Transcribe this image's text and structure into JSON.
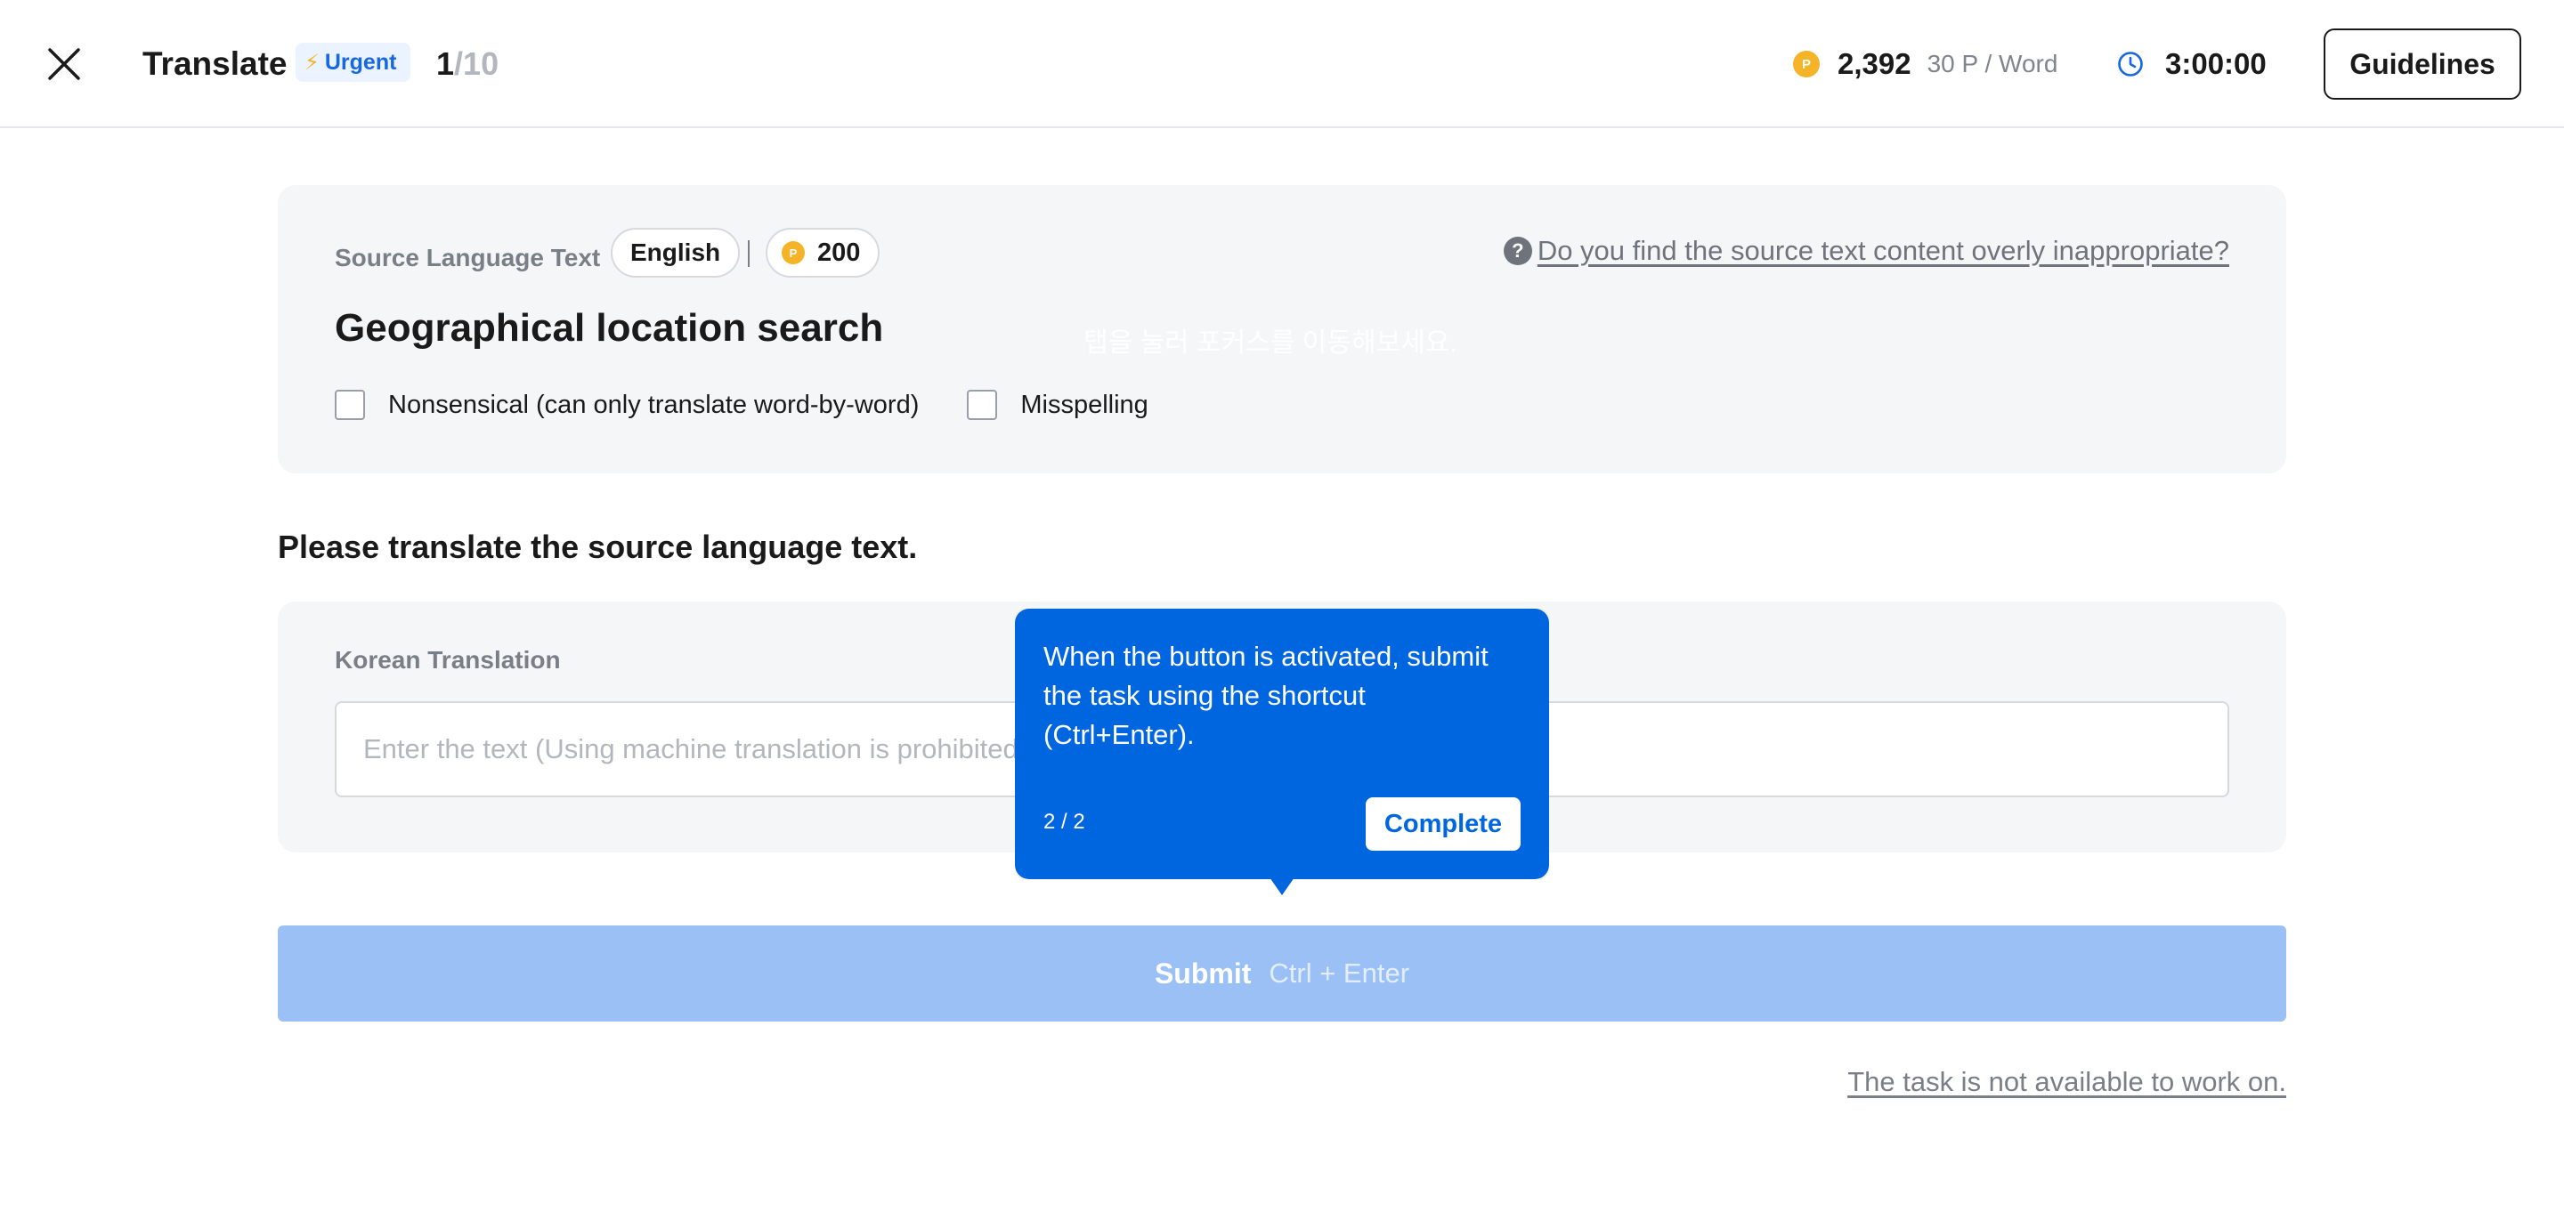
{
  "header": {
    "title": "Translate",
    "urgent_label": "Urgent",
    "progress_current": "1",
    "progress_separator": "/",
    "progress_total": "10",
    "points_coin": "P",
    "points_value": "2,392",
    "points_rate": "30 P / Word",
    "timer_value": "3:00:00",
    "guidelines_label": "Guidelines"
  },
  "source": {
    "label": "Source Language Text",
    "language": "English",
    "points_coin": "P",
    "points": "200",
    "report_icon": "?",
    "report_link": "Do you find the source text content overly inappropriate?",
    "text": "Geographical location search",
    "ghost_hint": "탭을 눌러 포커스를 이동해보세요.",
    "checkboxes": [
      {
        "label": "Nonsensical (can only translate word-by-word)"
      },
      {
        "label": "Misspelling"
      }
    ]
  },
  "instruction": "Please translate the source language text.",
  "translation": {
    "label": "Korean Translation",
    "placeholder": "Enter the text (Using machine translation is prohibited.)"
  },
  "submit": {
    "label": "Submit",
    "shortcut": "Ctrl + Enter"
  },
  "not_available_link": "The task is not available to work on.",
  "tooltip": {
    "text": "When the button is activated, submit the task using the shortcut (Ctrl+Enter).",
    "step": "2 / 2",
    "button_label": "Complete"
  },
  "icons": {
    "close": "close-icon",
    "bolt": "lightning-icon",
    "coin": "coin-icon",
    "clock": "clock-icon",
    "question": "question-icon"
  },
  "colors": {
    "accent": "#0066e0",
    "submit_disabled": "#9ac0f5",
    "coin": "#f5b327",
    "panel_bg": "#f5f6f8"
  }
}
